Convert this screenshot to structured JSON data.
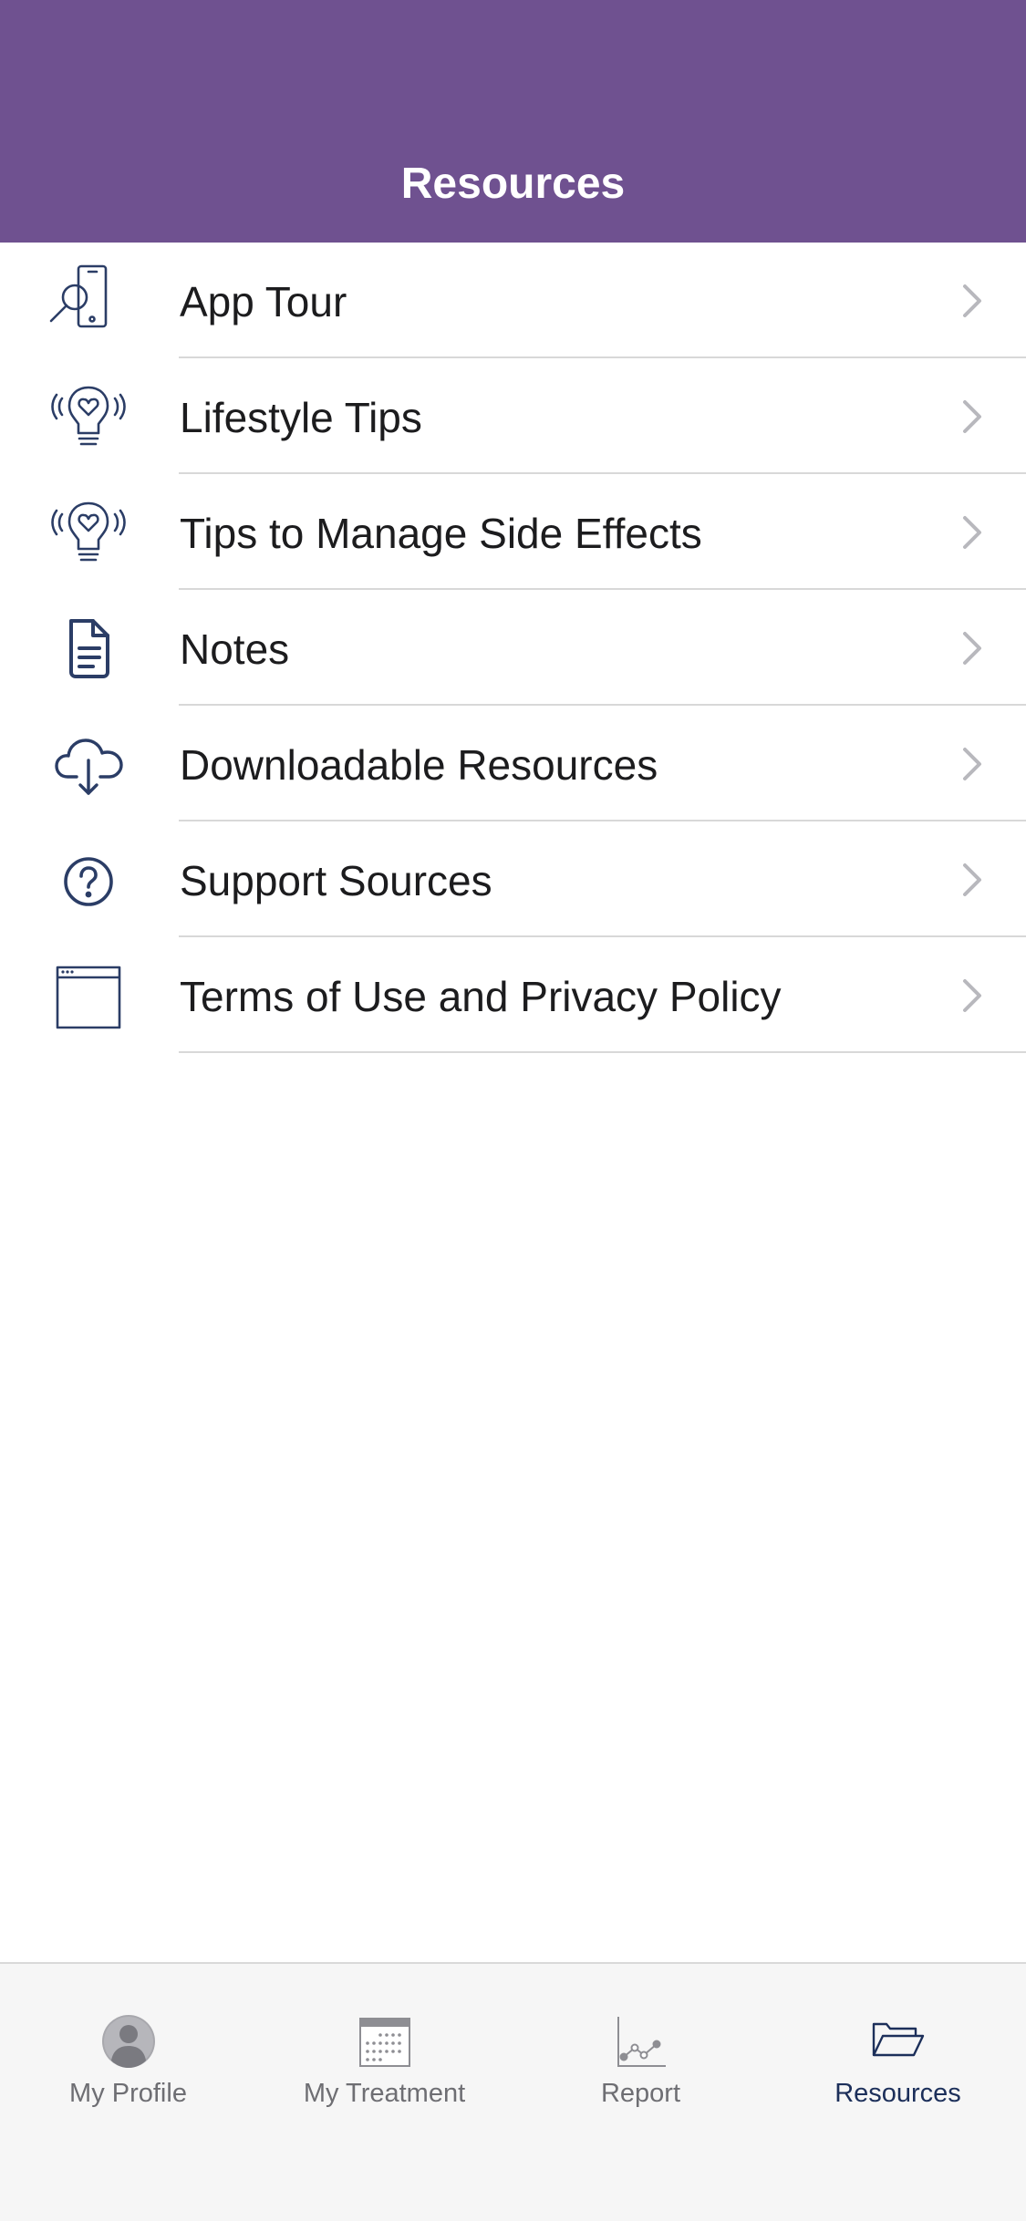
{
  "header": {
    "title": "Resources"
  },
  "list": {
    "items": [
      {
        "label": "App Tour",
        "icon": "phone-search-icon"
      },
      {
        "label": "Lifestyle Tips",
        "icon": "lightbulb-heart-icon"
      },
      {
        "label": "Tips to Manage Side Effects",
        "icon": "lightbulb-heart-icon"
      },
      {
        "label": "Notes",
        "icon": "document-icon"
      },
      {
        "label": "Downloadable Resources",
        "icon": "cloud-download-icon"
      },
      {
        "label": "Support Sources",
        "icon": "question-circle-icon"
      },
      {
        "label": "Terms of Use and Privacy Policy",
        "icon": "browser-window-icon"
      }
    ]
  },
  "tabbar": {
    "tabs": [
      {
        "label": "My Profile",
        "icon": "person-icon",
        "active": false
      },
      {
        "label": "My Treatment",
        "icon": "calendar-icon",
        "active": false
      },
      {
        "label": "Report",
        "icon": "line-chart-icon",
        "active": false
      },
      {
        "label": "Resources",
        "icon": "folder-icon",
        "active": true
      }
    ]
  },
  "colors": {
    "header_bg": "#6f5190",
    "icon_navy": "#2b3d66",
    "active_tab": "#1c2f5a",
    "inactive_tab": "#6e6e73",
    "separator": "#d8d8d8",
    "chevron": "#b8b8bd"
  }
}
